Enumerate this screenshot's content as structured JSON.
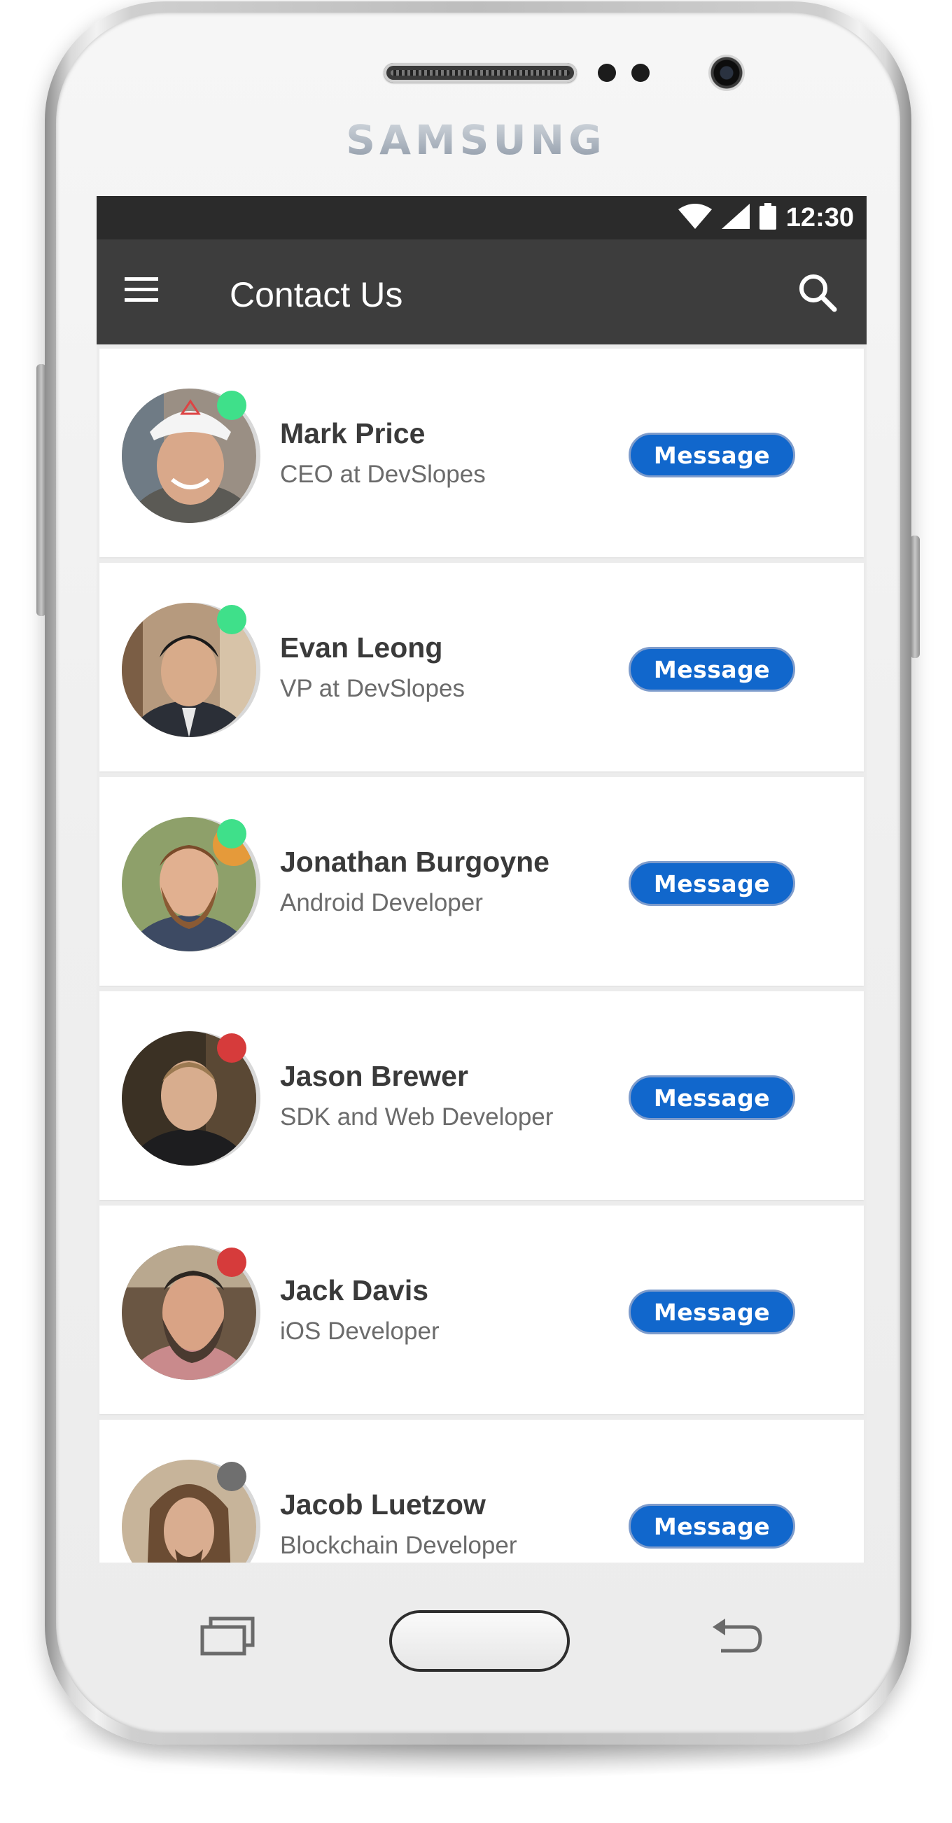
{
  "device": {
    "brand": "SAMSUNG"
  },
  "status_bar": {
    "time": "12:30",
    "icons": [
      "wifi-icon",
      "signal-icon",
      "battery-icon"
    ]
  },
  "app_bar": {
    "title": "Contact Us",
    "left_icon": "menu-icon",
    "right_icon": "search-icon"
  },
  "colors": {
    "status_bar": "#2b2b2b",
    "app_bar": "#3d3d3d",
    "button": "#1167cc",
    "online": "#3fe08a",
    "busy": "#d63b3b",
    "offline": "#6f6f6f"
  },
  "contacts": [
    {
      "name": "Mark Price",
      "role": "CEO at DevSlopes",
      "status": "online",
      "button_label": "Message"
    },
    {
      "name": "Evan Leong",
      "role": "VP at DevSlopes",
      "status": "online",
      "button_label": "Message"
    },
    {
      "name": "Jonathan Burgoyne",
      "role": "Android Developer",
      "status": "online",
      "button_label": "Message"
    },
    {
      "name": "Jason Brewer",
      "role": "SDK and Web Developer",
      "status": "busy",
      "button_label": "Message"
    },
    {
      "name": "Jack Davis",
      "role": "iOS Developer",
      "status": "busy",
      "button_label": "Message"
    },
    {
      "name": "Jacob Luetzow",
      "role": "Blockchain Developer",
      "status": "offline",
      "button_label": "Message"
    }
  ],
  "nav_keys": [
    "recent-apps-icon",
    "home-button",
    "back-icon"
  ]
}
